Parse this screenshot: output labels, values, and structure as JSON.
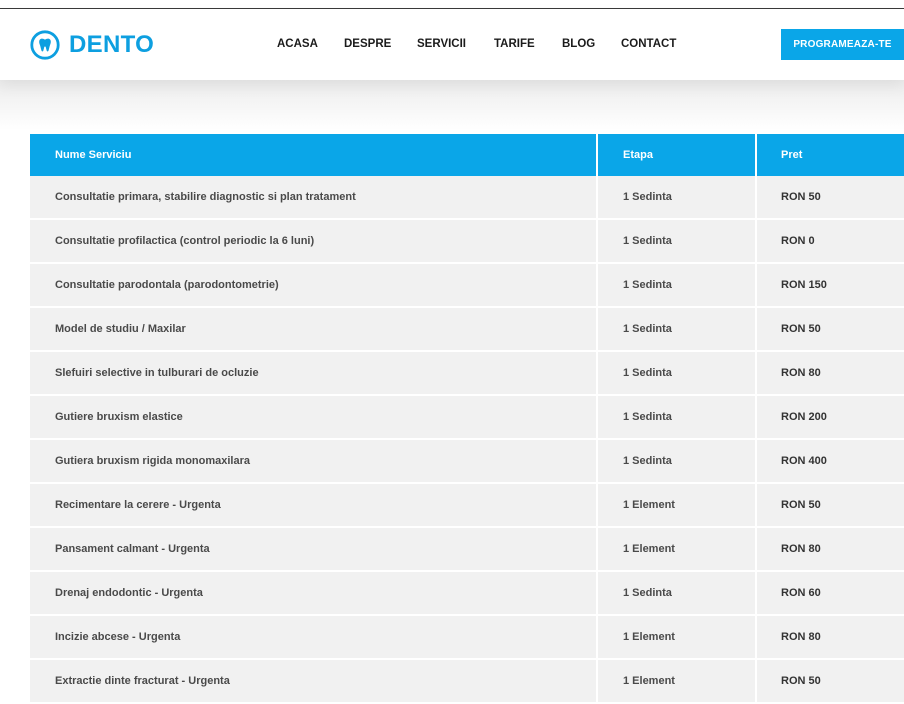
{
  "brand": {
    "name": "DENTO",
    "accent_color": "#0aa6e8",
    "icon": "tooth-icon"
  },
  "nav": {
    "items": [
      {
        "label": "ACASA",
        "slug": "acasa"
      },
      {
        "label": "DESPRE",
        "slug": "despre"
      },
      {
        "label": "SERVICII",
        "slug": "servicii"
      },
      {
        "label": "TARIFE",
        "slug": "tarife"
      },
      {
        "label": "BLOG",
        "slug": "blog"
      },
      {
        "label": "CONTACT",
        "slug": "contact"
      }
    ],
    "cta_label": "PROGRAMEAZA-TE"
  },
  "price_table": {
    "headers": [
      "Nume Serviciu",
      "Etapa",
      "Pret"
    ],
    "rows": [
      [
        "Consultatie primara, stabilire diagnostic si plan tratament",
        "1 Sedinta",
        "RON 50"
      ],
      [
        "Consultatie profilactica (control periodic la 6 luni)",
        "1 Sedinta",
        "RON 0"
      ],
      [
        "Consultatie parodontala (parodontometrie)",
        "1 Sedinta",
        "RON 150"
      ],
      [
        "Model de studiu / Maxilar",
        "1 Sedinta",
        "RON 50"
      ],
      [
        "Slefuiri selective in tulburari de ocluzie",
        "1 Sedinta",
        "RON 80"
      ],
      [
        "Gutiere bruxism elastice",
        "1 Sedinta",
        "RON 200"
      ],
      [
        "Gutiera bruxism rigida monomaxilara",
        "1 Sedinta",
        "RON 400"
      ],
      [
        "Recimentare la cerere - Urgenta",
        "1 Element",
        "RON 50"
      ],
      [
        "Pansament calmant - Urgenta",
        "1 Element",
        "RON 80"
      ],
      [
        "Drenaj endodontic - Urgenta",
        "1 Sedinta",
        "RON 60"
      ],
      [
        "Incizie abcese - Urgenta",
        "1 Element",
        "RON 80"
      ],
      [
        "Extractie dinte fracturat - Urgenta",
        "1 Element",
        "RON 50"
      ]
    ]
  }
}
